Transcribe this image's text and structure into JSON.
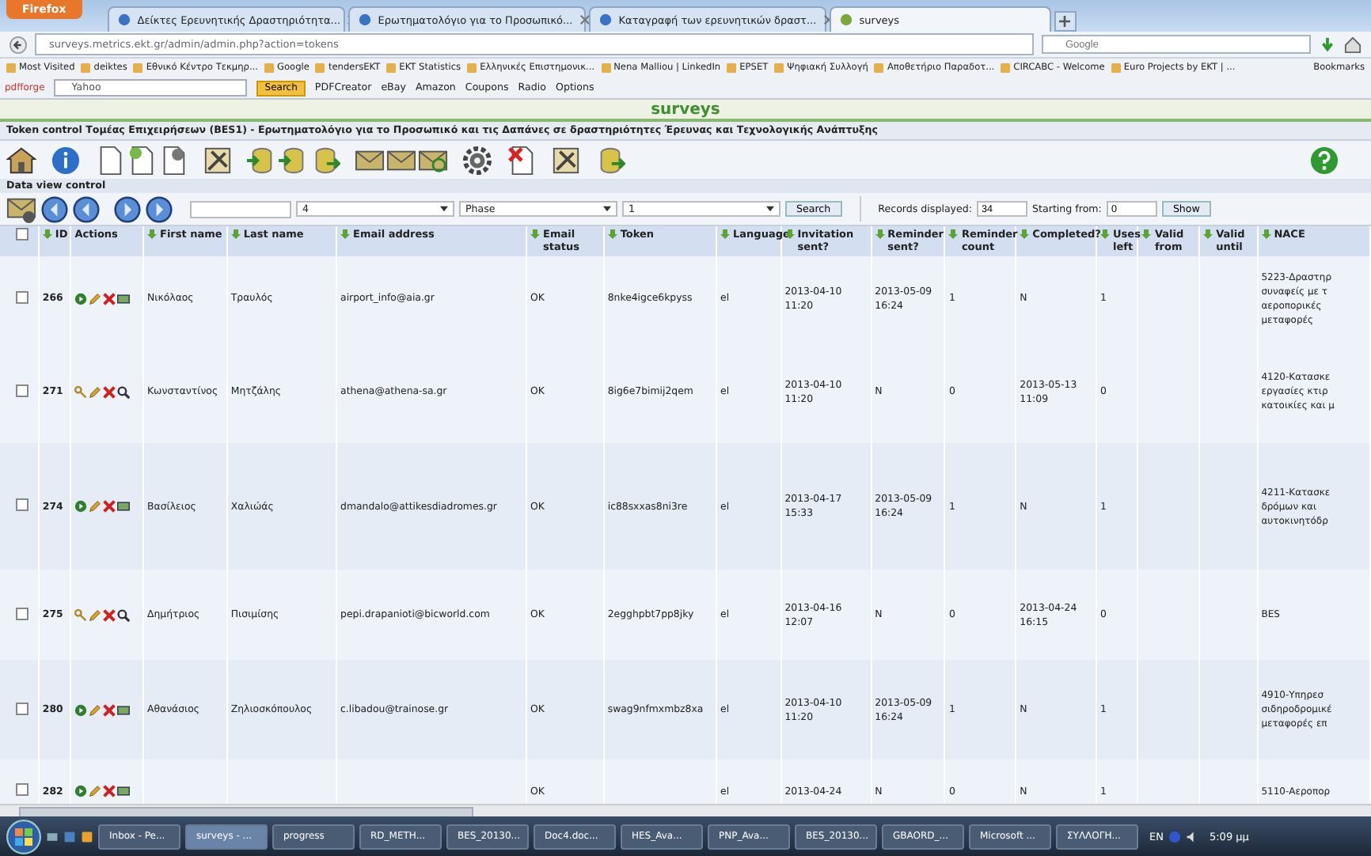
{
  "browser": {
    "menu_button": "Firefox",
    "tabs": [
      {
        "label": "Δείκτες Ερευνητικής Δραστηριότητα...",
        "selected": false
      },
      {
        "label": "Ερωτηματολόγιο για το Προσωπικό...",
        "selected": false
      },
      {
        "label": "Καταγραφή των ερευνητικών δραστ...",
        "selected": false
      },
      {
        "label": "surveys",
        "selected": true
      }
    ],
    "url": "surveys.metrics.ekt.gr/admin/admin.php?action=tokens",
    "search_placeholder": "Google",
    "bookmarks": [
      "Most Visited",
      "deiktes",
      "Εθνικό Κέντρο Τεκμηρ...",
      "Google",
      "tendersEKT",
      "EKT Statistics",
      "Ελληνικές Επιστημονικ...",
      "Nena Malliou | LinkedIn",
      "EPSET",
      "Ψηφιακή Συλλογή",
      "Αποθετήριο Παραδοτ...",
      "CIRCABC - Welcome",
      "Euro Projects by EKT | ..."
    ],
    "bookmarks_menu": "Bookmarks",
    "addon_bar": {
      "brand": "pdfforge",
      "search_engine": "Yahoo",
      "search_button": "Search",
      "items": [
        "PDFCreator",
        "eBay",
        "Amazon",
        "Coupons",
        "Radio",
        "Options"
      ]
    }
  },
  "page": {
    "site_title": "surveys",
    "section_title": "Token control Τομέας Επιχειρήσεων (BES1) - Ερωτηματολόγιο για το Προσωπικό και τις Δαπάνες σε δραστηριότητες Έρευνας και Τεχνολογικής Ανάπτυξης",
    "data_view_label": "Data view control",
    "filters": {
      "select_1": "4",
      "select_2": "Phase",
      "select_3": "1",
      "search_button": "Search",
      "records_label": "Records displayed:",
      "records_value": "34",
      "start_label": "Starting from:",
      "start_value": "0",
      "show_button": "Show"
    },
    "table": {
      "select_all_checked": false,
      "columns": [
        "ID",
        "Actions",
        "First name",
        "Last name",
        "Email address",
        "Email status",
        "Token",
        "Language",
        "Invitation sent?",
        "Reminder sent?",
        "Reminder count",
        "Completed?",
        "Uses left",
        "Valid from",
        "Valid until",
        "NACE"
      ],
      "rows": [
        {
          "checked": false,
          "kind": "send",
          "id": "266",
          "first": "Νικόλαος",
          "last": "Τραυλός",
          "email": "airport_info@aia.gr",
          "status": "OK",
          "token": "8nke4igce6kpyss",
          "lang": "el",
          "invited": [
            "2013-04-10",
            "11:20"
          ],
          "reminded": [
            "2013-05-09",
            "16:24"
          ],
          "count": "1",
          "completed": [
            "N"
          ],
          "uses": "1",
          "nace": [
            "5223-Δραστηρ",
            "συναφείς με τ",
            "αεροπορικές",
            "μεταφορές"
          ]
        },
        {
          "checked": false,
          "kind": "view",
          "id": "271",
          "first": "Κωνσταντίνος",
          "last": "Μητζάλης",
          "email": "athena@athena-sa.gr",
          "status": "OK",
          "token": "8ig6e7bimij2qem",
          "lang": "el",
          "invited": [
            "2013-04-10",
            "11:20"
          ],
          "reminded": [
            "N"
          ],
          "count": "0",
          "completed": [
            "2013-05-13",
            "11:09"
          ],
          "uses": "0",
          "nace": [
            "4120-Κατασκε",
            "εργασίες κτιρ",
            "κατοικίες και μ"
          ]
        },
        {
          "checked": false,
          "kind": "send",
          "id": "274",
          "first": "Βασίλειος",
          "last": "Χαλιώάς",
          "email": "dmandalo@attikesdiadromes.gr",
          "status": "OK",
          "token": "ic88sxxas8ni3re",
          "lang": "el",
          "invited": [
            "2013-04-17",
            "15:33"
          ],
          "reminded": [
            "2013-05-09",
            "16:24"
          ],
          "count": "1",
          "completed": [
            "N"
          ],
          "uses": "1",
          "nace": [
            "4211-Κατασκε",
            "δρόμων και",
            "αυτοκινητόδρ"
          ]
        },
        {
          "checked": false,
          "kind": "view",
          "id": "275",
          "first": "Δημήτριος",
          "last": "Πισιμίσης",
          "email": "pepi.drapanioti@bicworld.com",
          "status": "OK",
          "token": "2egghpbt7pp8jky",
          "lang": "el",
          "invited": [
            "2013-04-16",
            "12:07"
          ],
          "reminded": [
            "N"
          ],
          "count": "0",
          "completed": [
            "2013-04-24",
            "16:15"
          ],
          "uses": "0",
          "nace": [
            "BES"
          ]
        },
        {
          "checked": false,
          "kind": "send",
          "id": "280",
          "first": "Αθανάσιος",
          "last": "Ζηλιοσκόπουλος",
          "email": "c.libadou@trainose.gr",
          "status": "OK",
          "token": "swag9nfmxmbz8xa",
          "lang": "el",
          "invited": [
            "2013-04-10",
            "11:20"
          ],
          "reminded": [
            "2013-05-09",
            "16:24"
          ],
          "count": "1",
          "completed": [
            "N"
          ],
          "uses": "1",
          "nace": [
            "4910-Υπηρεσ",
            "σιδηροδρομικέ",
            "μεταφορές επ"
          ]
        },
        {
          "checked": false,
          "kind": "send",
          "id": "282",
          "status": "OK",
          "lang": "el",
          "invited": [
            "2013-04-24"
          ],
          "reminded": [
            "N"
          ],
          "count": "0",
          "completed": [
            "N"
          ],
          "uses": "1",
          "nace": [
            "5110-Αεροπορ"
          ]
        }
      ]
    }
  },
  "taskbar": {
    "items": [
      "Inbox - Pe...",
      "surveys - ...",
      "progress",
      "RD_METH...",
      "BES_20130...",
      "Doc4.doc...",
      "HES_Ava...",
      "PNP_Ava...",
      "BES_20130...",
      "GBAORD_...",
      "Microsoft ...",
      "ΣΥΛΛΟΓΗ..."
    ],
    "language": "EN",
    "clock": "5:09 μμ"
  }
}
